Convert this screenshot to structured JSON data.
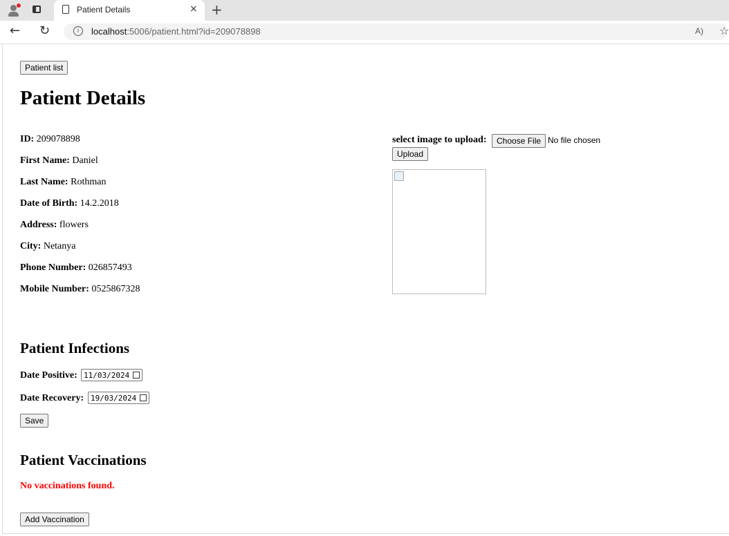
{
  "browser": {
    "tab_title": "Patient Details",
    "url_host": "localhost",
    "url_rest": ":5006/patient.html?id=209078898",
    "read_aloud": "A)",
    "close_glyph": "×",
    "new_tab_glyph": "+",
    "back_glyph": "←",
    "reload_glyph": "↻",
    "info_glyph": "i",
    "favorite_glyph": "☆"
  },
  "page": {
    "patient_list_button": "Patient list",
    "title": "Patient Details",
    "fields": [
      {
        "label": "ID:",
        "value": "209078898"
      },
      {
        "label": "First Name:",
        "value": "Daniel"
      },
      {
        "label": "Last Name:",
        "value": "Rothman"
      },
      {
        "label": "Date of Birth:",
        "value": "14.2.2018"
      },
      {
        "label": "Address:",
        "value": "flowers"
      },
      {
        "label": "City:",
        "value": "Netanya"
      },
      {
        "label": "Phone Number:",
        "value": "026857493"
      },
      {
        "label": "Mobile Number:",
        "value": "0525867328"
      }
    ],
    "upload": {
      "label": "select image to upload:",
      "choose_file": "Choose File",
      "no_file": "No file chosen",
      "upload_button": "Upload"
    },
    "infections": {
      "heading": "Patient Infections",
      "date_positive_label": "Date Positive:",
      "date_positive_value": "11/03/2024",
      "date_recovery_label": "Date Recovery:",
      "date_recovery_value": "19/03/2024",
      "save_button": "Save"
    },
    "vaccinations": {
      "heading": "Patient Vaccinations",
      "empty_message": "No vaccinations found.",
      "add_button": "Add Vaccination"
    }
  }
}
